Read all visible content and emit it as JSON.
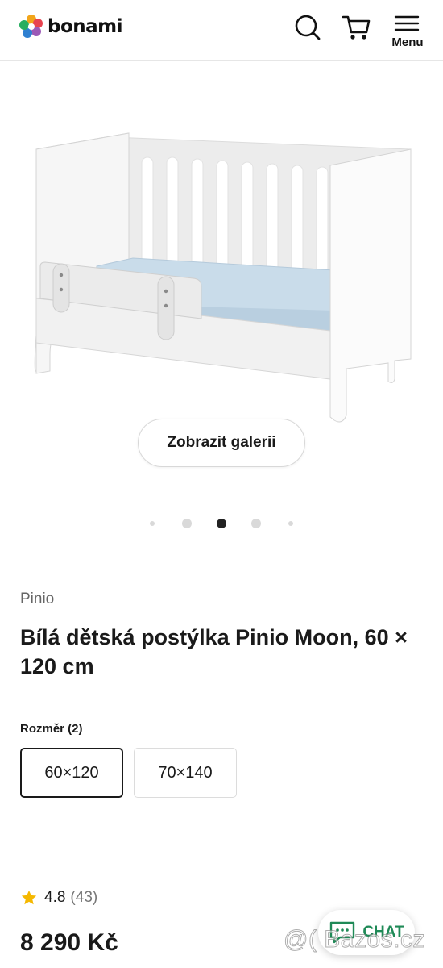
{
  "header": {
    "logo_text": "bonami",
    "menu_label": "Menu",
    "icons": [
      "logo-mark-icon",
      "search-icon",
      "cart-icon",
      "hamburger-menu-icon"
    ]
  },
  "gallery": {
    "button_label": "Zobrazit galerii",
    "slide_count": 5,
    "active_slide": 3
  },
  "product": {
    "brand": "Pinio",
    "title": "Bílá dětská postýlka Pinio Moon, 60 × 120 cm",
    "size_label": "Rozměr (2)",
    "sizes": [
      "60×120",
      "70×140"
    ],
    "selected_size": "60×120",
    "rating": "4.8",
    "rating_count": "(43)",
    "price": "8 290 Kč"
  },
  "chat": {
    "label": "CHAT",
    "color": "#1f8a57"
  },
  "watermark": "@( Bazos.cz",
  "colors": {
    "star": "#f5b800",
    "text": "#1a1a1a",
    "mattress": "#c9dcea"
  }
}
